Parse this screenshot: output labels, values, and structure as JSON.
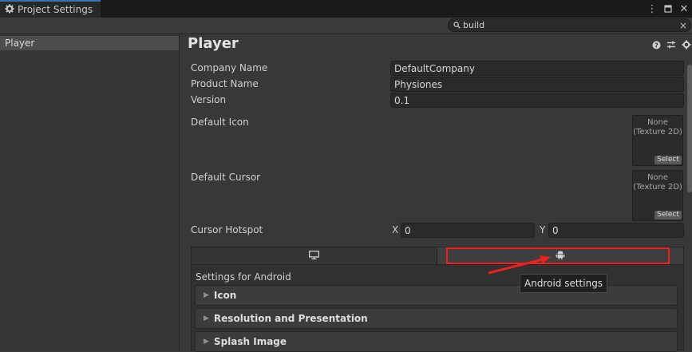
{
  "window": {
    "tab_title": "Project Settings",
    "icons": [
      "gear-icon",
      "more-vertical-icon",
      "maximize-icon",
      "close-icon"
    ]
  },
  "search": {
    "value": "build",
    "placeholder": ""
  },
  "sidebar": {
    "items": [
      {
        "label": "Player",
        "selected": true
      }
    ]
  },
  "main": {
    "title": "Player",
    "header_icons": [
      "help-icon",
      "preset-icon",
      "settings-icon"
    ],
    "company_name": {
      "label": "Company Name",
      "value": "DefaultCompany"
    },
    "product_name": {
      "label": "Product Name",
      "value": "Physiones"
    },
    "version": {
      "label": "Version",
      "value": "0.1"
    },
    "default_icon": {
      "label": "Default Icon",
      "none_line1": "None",
      "none_line2": "(Texture 2D)",
      "select": "Select"
    },
    "default_cursor": {
      "label": "Default Cursor",
      "none_line1": "None",
      "none_line2": "(Texture 2D)",
      "select": "Select"
    },
    "cursor_hotspot": {
      "label": "Cursor Hotspot",
      "x_label": "X",
      "x_value": "0",
      "y_label": "Y",
      "y_value": "0"
    }
  },
  "platform": {
    "tabs": [
      {
        "icon": "monitor-icon",
        "selected": false
      },
      {
        "icon": "android-icon",
        "selected": true
      }
    ],
    "settings_label": "Settings for Android",
    "sections": [
      {
        "label": "Icon"
      },
      {
        "label": "Resolution and Presentation"
      },
      {
        "label": "Splash Image"
      }
    ],
    "tooltip": "Android settings"
  },
  "colors": {
    "highlight": "#f02020",
    "background": "#383838",
    "field": "#2a2a2a"
  }
}
